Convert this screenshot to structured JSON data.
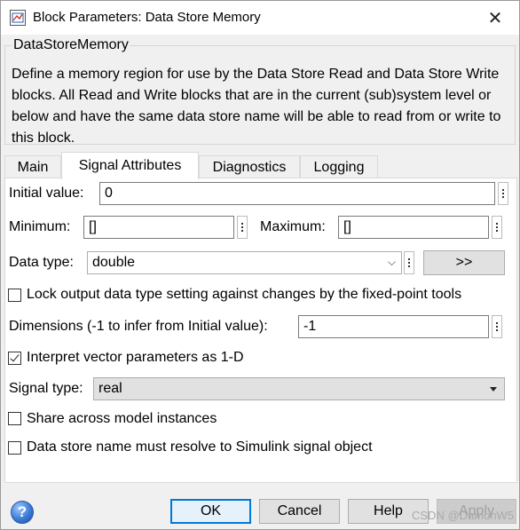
{
  "window": {
    "title": "Block Parameters: Data Store Memory",
    "close_glyph": "✕",
    "app_icon": "simulink-block-icon"
  },
  "group": {
    "legend": "DataStoreMemory",
    "description": "Define a memory region for use by the Data Store Read and Data Store Write blocks. All Read and Write blocks that are in the current (sub)system level or below and have the same data store name will be able to read from or write to this block."
  },
  "tabs": [
    {
      "label": "Main",
      "active": false
    },
    {
      "label": "Signal Attributes",
      "active": true
    },
    {
      "label": "Diagnostics",
      "active": false
    },
    {
      "label": "Logging",
      "active": false
    }
  ],
  "signal_attributes": {
    "initial_value_label": "Initial value:",
    "initial_value": "0",
    "minimum_label": "Minimum:",
    "minimum": "[]",
    "maximum_label": "Maximum:",
    "maximum": "[]",
    "data_type_label": "Data type:",
    "data_type": "double",
    "data_type_assistant": ">>",
    "lock_label": "Lock output data type setting against changes by the fixed-point tools",
    "lock_checked": false,
    "dimensions_label": "Dimensions (-1 to infer from Initial value):",
    "dimensions": "-1",
    "interpret_label": "Interpret vector parameters as 1-D",
    "interpret_checked": true,
    "signal_type_label": "Signal type:",
    "signal_type": "real",
    "share_label": "Share across model instances",
    "share_checked": false,
    "resolve_label": "Data store name must resolve to Simulink signal object",
    "resolve_checked": false
  },
  "buttons": {
    "ok": "OK",
    "cancel": "Cancel",
    "help": "Help",
    "apply": "Apply",
    "help_icon_glyph": "?"
  },
  "watermark": "CSDN @DamonW5",
  "colors": {
    "accent": "#0078d7",
    "dialog_bg": "#f0f0f0",
    "panel_bg": "#ffffff"
  }
}
